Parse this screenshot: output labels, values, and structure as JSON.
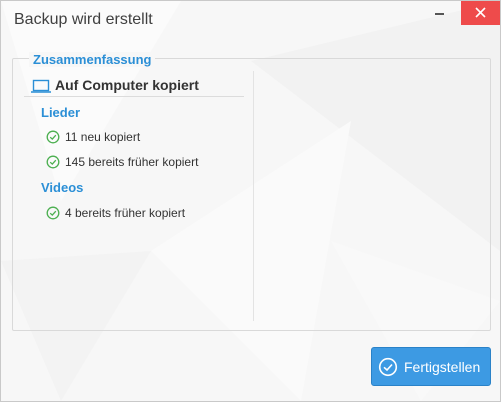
{
  "window": {
    "title": "Backup wird erstellt",
    "close_icon": "close-icon",
    "minimize_icon": "minimize-icon"
  },
  "summary": {
    "legend": "Zusammenfassung",
    "section_title": "Auf Computer kopiert",
    "section_icon": "laptop-icon",
    "categories": [
      {
        "label": "Lieder",
        "items": [
          {
            "text": "11 neu kopiert",
            "icon": "check-circle-icon"
          },
          {
            "text": "145 bereits früher kopiert",
            "icon": "check-circle-icon"
          }
        ]
      },
      {
        "label": "Videos",
        "items": [
          {
            "text": "4 bereits früher kopiert",
            "icon": "check-circle-icon"
          }
        ]
      }
    ]
  },
  "footer": {
    "finish_label": "Fertigstellen",
    "finish_icon": "check-circle-icon"
  },
  "colors": {
    "accent": "#2b8fd6",
    "button": "#3d9ae3",
    "close": "#ee4b4b",
    "check": "#4caf50"
  }
}
